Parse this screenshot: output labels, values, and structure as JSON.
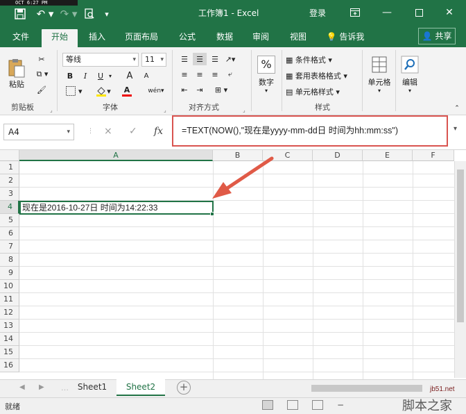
{
  "clock": "OCT  6:27 PM",
  "window": {
    "title": "工作簿1 - Excel",
    "login": "登录"
  },
  "tabs": [
    {
      "label": "文件"
    },
    {
      "label": "开始"
    },
    {
      "label": "插入"
    },
    {
      "label": "页面布局"
    },
    {
      "label": "公式"
    },
    {
      "label": "数据"
    },
    {
      "label": "审阅"
    },
    {
      "label": "视图"
    }
  ],
  "tell_me": "告诉我",
  "share": "共享",
  "ribbon": {
    "clipboard": {
      "paste": "粘贴",
      "label": "剪贴板"
    },
    "font": {
      "name": "等线",
      "size": "11",
      "bold": "B",
      "italic": "I",
      "underline": "U",
      "grow": "A",
      "shrink": "A",
      "color": "A",
      "phonetic": "wén",
      "label": "字体"
    },
    "alignment": {
      "label": "对齐方式"
    },
    "number": {
      "label": "数字",
      "symbol": "%"
    },
    "styles": {
      "conditional": "条件格式",
      "table": "套用表格格式",
      "cell": "单元格样式",
      "label": "样式"
    },
    "cells": {
      "label": "单元格"
    },
    "editing": {
      "label": "编辑"
    }
  },
  "formula_bar": {
    "name_box": "A4",
    "cancel": "×",
    "enter": "✓",
    "fx": "fx",
    "formula": "=TEXT(NOW(),\"现在是yyyy-mm-dd日 时间为hh:mm:ss\")"
  },
  "grid": {
    "columns": [
      "A",
      "B",
      "C",
      "D",
      "E",
      "F"
    ],
    "rows": [
      "1",
      "2",
      "3",
      "4",
      "5",
      "6",
      "7",
      "8",
      "9",
      "10",
      "11",
      "12",
      "13",
      "14",
      "15",
      "16"
    ],
    "a4": "现在是2016-10-27日 时间为14:22:33"
  },
  "sheets": [
    {
      "label": "Sheet1"
    },
    {
      "label": "Sheet2"
    }
  ],
  "add_sheet": "+",
  "status": "就绪",
  "watermark": {
    "url": "jb51.net",
    "name": "脚本之家"
  },
  "colors": {
    "accent": "#217346",
    "highlight_box": "#d9534f",
    "arrow": "#e05a47"
  }
}
